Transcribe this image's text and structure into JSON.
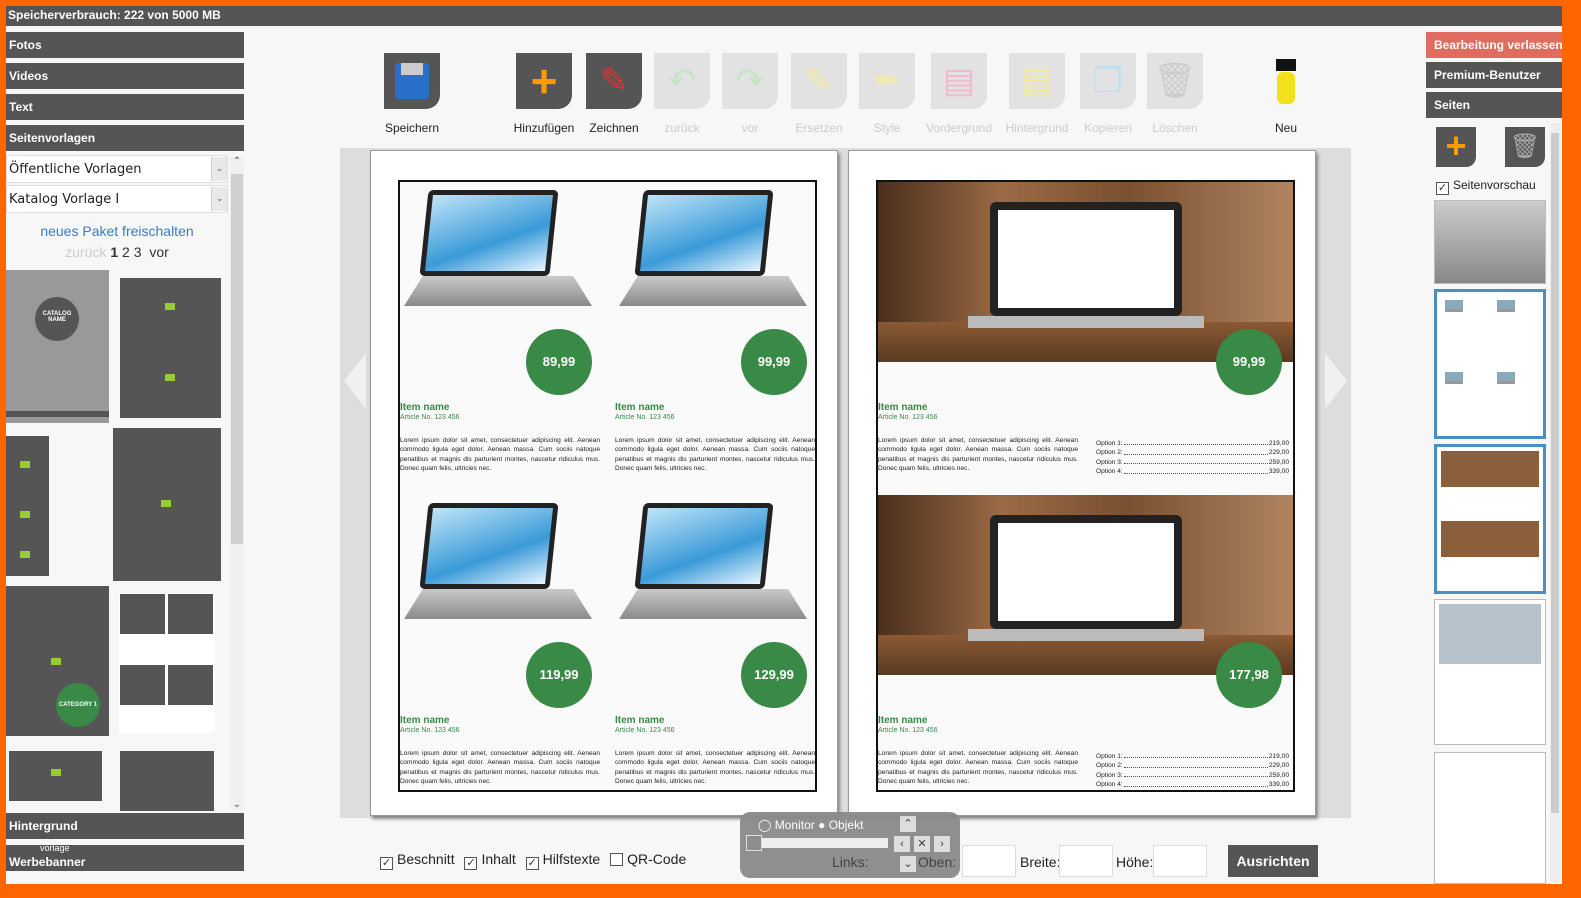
{
  "storage": "Speicherverbrauch: 222 von 5000 MB",
  "left": {
    "sections": [
      "Fotos",
      "Videos",
      "Text",
      "Seitenvorlagen"
    ],
    "bottom_sections": [
      "Hintergrund",
      "Werbebanner"
    ],
    "bottom_overlay": "vorlage",
    "select1": "Öffentliche Vorlagen",
    "select2": "Katalog Vorlage I",
    "unlock_link": "neues Paket freischalten",
    "pager": {
      "prev": "zurück",
      "pages": [
        "1",
        "2",
        "3"
      ],
      "next": "vor",
      "current": "1"
    },
    "thumb_texts": {
      "catalog_name": "CATALOG NAME",
      "category": "CATEGORY 1"
    }
  },
  "toolbar": {
    "save": "Speichern",
    "tools": [
      {
        "label": "Hinzufügen",
        "icon": "plus-icon",
        "enabled": true
      },
      {
        "label": "Zeichnen",
        "icon": "brush-icon",
        "enabled": true
      },
      {
        "label": "zurück",
        "icon": "undo-icon",
        "enabled": false
      },
      {
        "label": "vor",
        "icon": "redo-icon",
        "enabled": false
      },
      {
        "label": "Ersetzen",
        "icon": "pencil-icon",
        "enabled": false
      },
      {
        "label": "Style",
        "icon": "pen-icon",
        "enabled": false
      },
      {
        "label": "Vordergrund",
        "icon": "bring-forward-icon",
        "enabled": false
      },
      {
        "label": "Hintergrund",
        "icon": "send-backward-icon",
        "enabled": false
      },
      {
        "label": "Kopieren",
        "icon": "copy-icon",
        "enabled": false
      },
      {
        "label": "Löschen",
        "icon": "trash-icon",
        "enabled": false
      }
    ],
    "new": "Neu"
  },
  "pages": {
    "left": [
      {
        "price": "89,99",
        "name": "Item name",
        "article": "Article No. 123 456"
      },
      {
        "price": "99,99",
        "name": "Item name",
        "article": "Article No. 123 456"
      },
      {
        "price": "119,99",
        "name": "Item name",
        "article": "Article No. 123 456"
      },
      {
        "price": "129,99",
        "name": "Item name",
        "article": "Article No. 123 456"
      }
    ],
    "right": [
      {
        "price": "99,99",
        "name": "Item name",
        "article": "Article No. 123 456"
      },
      {
        "price": "177,98",
        "name": "Item name",
        "article": "Article No. 123 456"
      }
    ],
    "lorem": "Lorem ipsum dolor sit amet, consectetuer adipiscing elit. Aenean commodo ligula eget dolor. Aenean massa. Cum sociis natoque penatibus et magnis dis parturient montes, nascetur ridiculus mus. Donec quam felis, ultricies nec.",
    "options": [
      {
        "label": "Option 1:",
        "value": "219,00"
      },
      {
        "label": "Option 2:",
        "value": "229,00"
      },
      {
        "label": "Option 3:",
        "value": "259,00"
      },
      {
        "label": "Option 4:",
        "value": "339,00"
      }
    ]
  },
  "right": {
    "leave": "Bearbeitung verlassen",
    "premium": "Premium-Benutzer",
    "pages": "Seiten",
    "preview": "Seitenvorschau",
    "preview_checked": true
  },
  "bottom": {
    "checks": [
      {
        "label": "Beschnitt",
        "checked": true
      },
      {
        "label": "Inhalt",
        "checked": true
      },
      {
        "label": "Hilfstexte",
        "checked": true
      },
      {
        "label": "QR-Code",
        "checked": false
      }
    ],
    "radio": {
      "monitor": "Monitor",
      "objekt": "Objekt",
      "selected": "Monitor"
    },
    "links": "Links:",
    "oben": "Oben:",
    "breite": "Breite:",
    "hoehe": "Höhe:",
    "align": "Ausrichten"
  },
  "colors": {
    "frame": "#ff6600",
    "panel": "#555555",
    "price": "#3a8a47",
    "leave": "#e06c60",
    "accent": "#ff9900"
  }
}
